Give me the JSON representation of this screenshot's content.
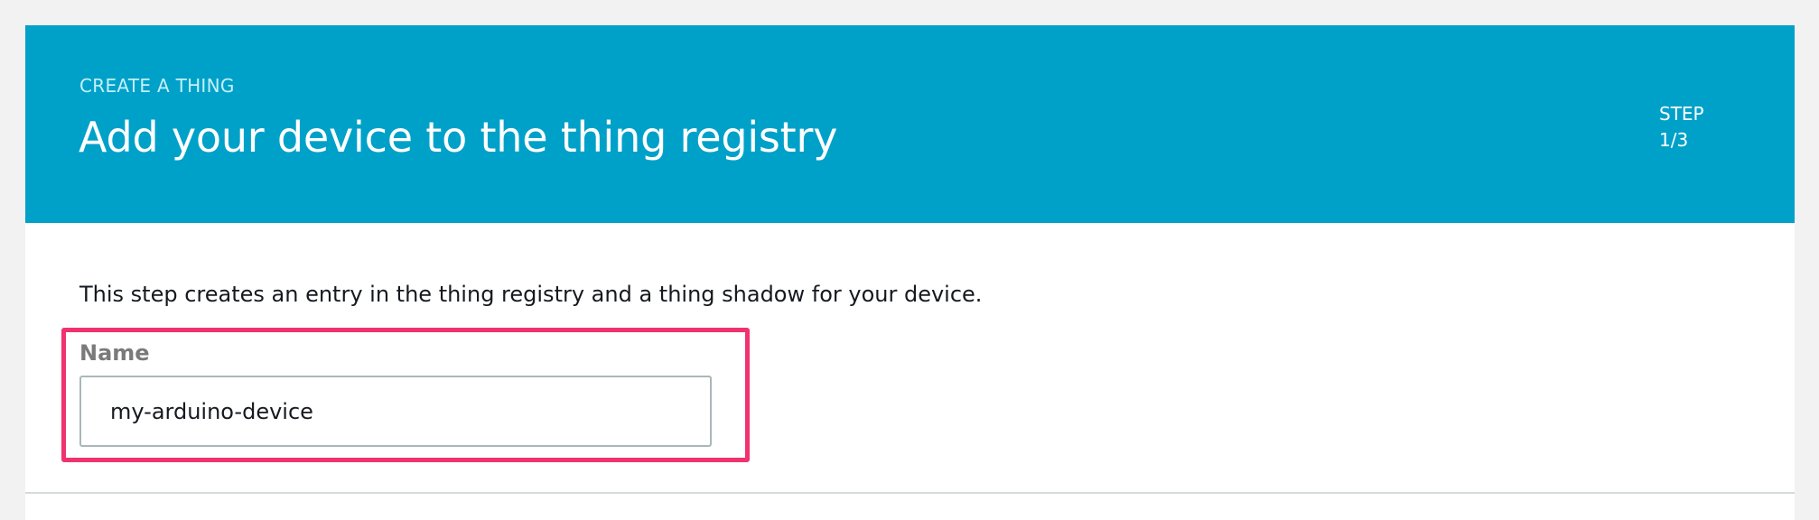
{
  "header": {
    "eyebrow": "CREATE A THING",
    "title": "Add your device to the thing registry",
    "step_label": "STEP",
    "step_value": "1/3"
  },
  "content": {
    "description": "This step creates an entry in the thing registry and a thing shadow for your device.",
    "name_field": {
      "label": "Name",
      "value": "my-arduino-device"
    }
  },
  "colors": {
    "banner": "#00a1c9",
    "highlight": "#f0336f",
    "page_background": "#f2f2f2"
  }
}
